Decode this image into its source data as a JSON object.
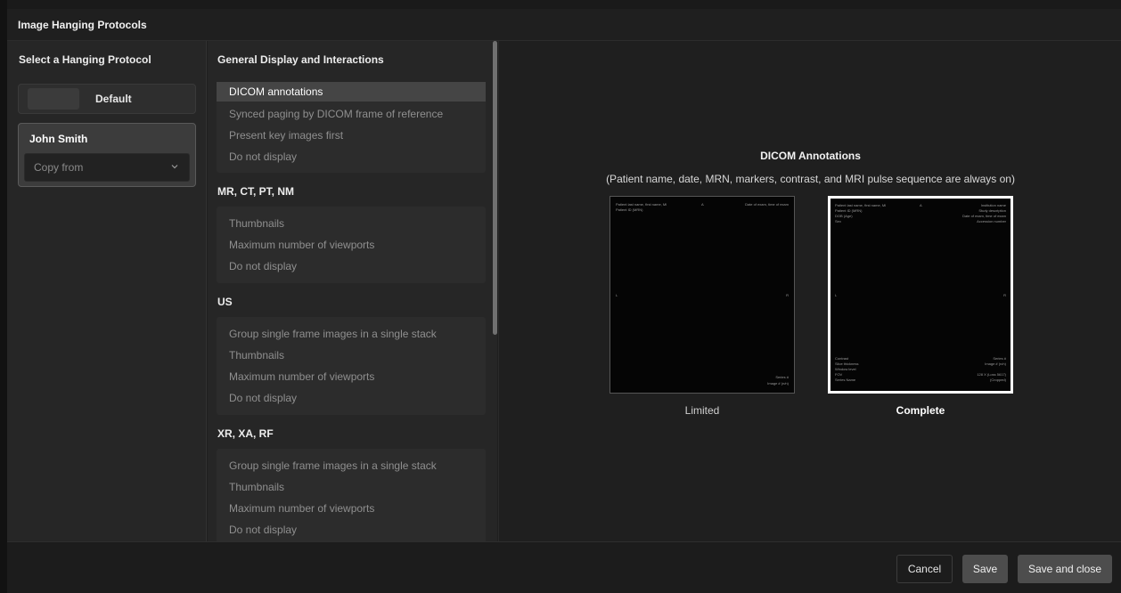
{
  "window": {
    "title": "Image Hanging Protocols"
  },
  "protocols": {
    "heading": "Select a Hanging Protocol",
    "items": [
      {
        "label": "Default",
        "selected": false
      },
      {
        "label": "John Smith",
        "selected": true
      }
    ],
    "copy_from": {
      "placeholder": "Copy from"
    }
  },
  "settings": {
    "sections": [
      {
        "title": "General Display and Interactions",
        "options": [
          "DICOM annotations",
          "Synced paging by DICOM frame of reference",
          "Present key images first",
          "Do not display"
        ],
        "selected": "DICOM annotations"
      },
      {
        "title": "MR, CT, PT, NM",
        "options": [
          "Thumbnails",
          "Maximum number of viewports",
          "Do not display"
        ]
      },
      {
        "title": "US",
        "options": [
          "Group single frame images in a single stack",
          "Thumbnails",
          "Maximum number of viewports",
          "Do not display"
        ]
      },
      {
        "title": "XR, XA, RF",
        "options": [
          "Group single frame images in a single stack",
          "Thumbnails",
          "Maximum number of viewports",
          "Do not display"
        ]
      }
    ]
  },
  "preview": {
    "title": "DICOM Annotations",
    "subtitle": "(Patient name, date, MRN, markers, contrast, and MRI pulse sequence are always on)",
    "limited": {
      "label": "Limited",
      "top_left": [
        "Patient last name, first name, MI",
        "Patient ID (MRN)"
      ],
      "top_center": "A",
      "top_right": [
        "Date of exam, time of exam"
      ],
      "mid_left": "L",
      "mid_right": "R",
      "bottom_right": [
        "Series #",
        "Image # (n/n)"
      ]
    },
    "complete": {
      "label": "Complete",
      "top_left": [
        "Patient last name, first name, MI",
        "Patient ID (MRN)",
        "DOB (Age)",
        "Sex"
      ],
      "top_center": "A",
      "top_right": [
        "Institution name",
        "Study description",
        "Date of exam, time of exam",
        "Accession number"
      ],
      "mid_left": "L",
      "mid_right": "R",
      "bottom_left": [
        "Contrast",
        "Slice thickness",
        "Window level",
        "FOV",
        "Series Name"
      ],
      "bottom_right": [
        "Series #",
        "Image # (n/n)",
        "",
        "128 X (Loss 5617)",
        "(Cropped)"
      ]
    }
  },
  "footer": {
    "cancel": "Cancel",
    "save": "Save",
    "save_close": "Save and close"
  }
}
